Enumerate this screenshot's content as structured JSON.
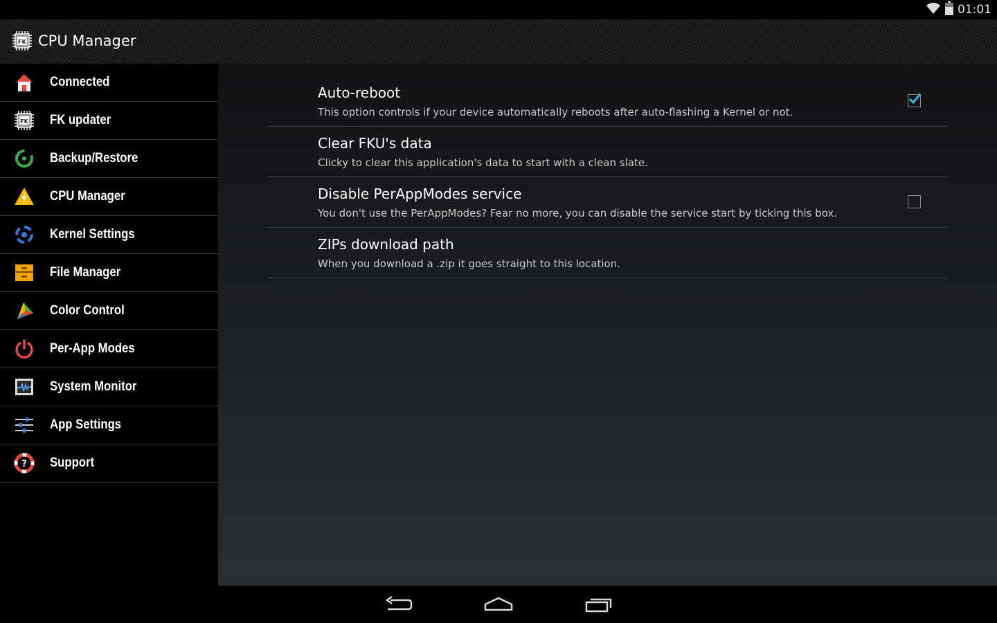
{
  "status": {
    "time": "01:01",
    "wifi_icon": "wifi-icon",
    "battery_icon": "battery-icon"
  },
  "action_bar": {
    "title": "CPU Manager",
    "icon": "fk-chip-icon"
  },
  "drawer": {
    "items": [
      {
        "label": "Connected",
        "icon": "home-icon"
      },
      {
        "label": "FK updater",
        "icon": "fk-chip-icon"
      },
      {
        "label": "Backup/Restore",
        "icon": "backup-icon"
      },
      {
        "label": "CPU Manager",
        "icon": "warning-bolt-icon"
      },
      {
        "label": "Kernel Settings",
        "icon": "kernel-settings-icon"
      },
      {
        "label": "File Manager",
        "icon": "file-cabinet-icon"
      },
      {
        "label": "Color Control",
        "icon": "color-prism-icon"
      },
      {
        "label": "Per-App Modes",
        "icon": "power-icon"
      },
      {
        "label": "System Monitor",
        "icon": "monitor-graph-icon"
      },
      {
        "label": "App Settings",
        "icon": "sliders-icon"
      },
      {
        "label": "Support",
        "icon": "lifebuoy-icon"
      }
    ]
  },
  "preferences": [
    {
      "title": "Auto-reboot",
      "summary": "This option controls if your device automatically reboots after auto-flashing a Kernel or not.",
      "has_checkbox": true,
      "checked": true
    },
    {
      "title": "Clear FKU's data",
      "summary": "Clicky to clear this application's data to start with a clean slate.",
      "has_checkbox": false
    },
    {
      "title": "Disable PerAppModes service",
      "summary": "You don't use the PerAppModes? Fear no more, you can disable the service start by ticking this box.",
      "has_checkbox": true,
      "checked": false
    },
    {
      "title": "ZIPs download path",
      "summary": "When you download a .zip it goes straight to this location.",
      "has_checkbox": false
    }
  ],
  "nav": {
    "back_icon": "back-icon",
    "home_icon": "home-nav-icon",
    "recents_icon": "recents-icon"
  },
  "colors": {
    "accent": "#33b5e5",
    "drawer_bg": "#000000",
    "divider": "#3a3a3a"
  }
}
